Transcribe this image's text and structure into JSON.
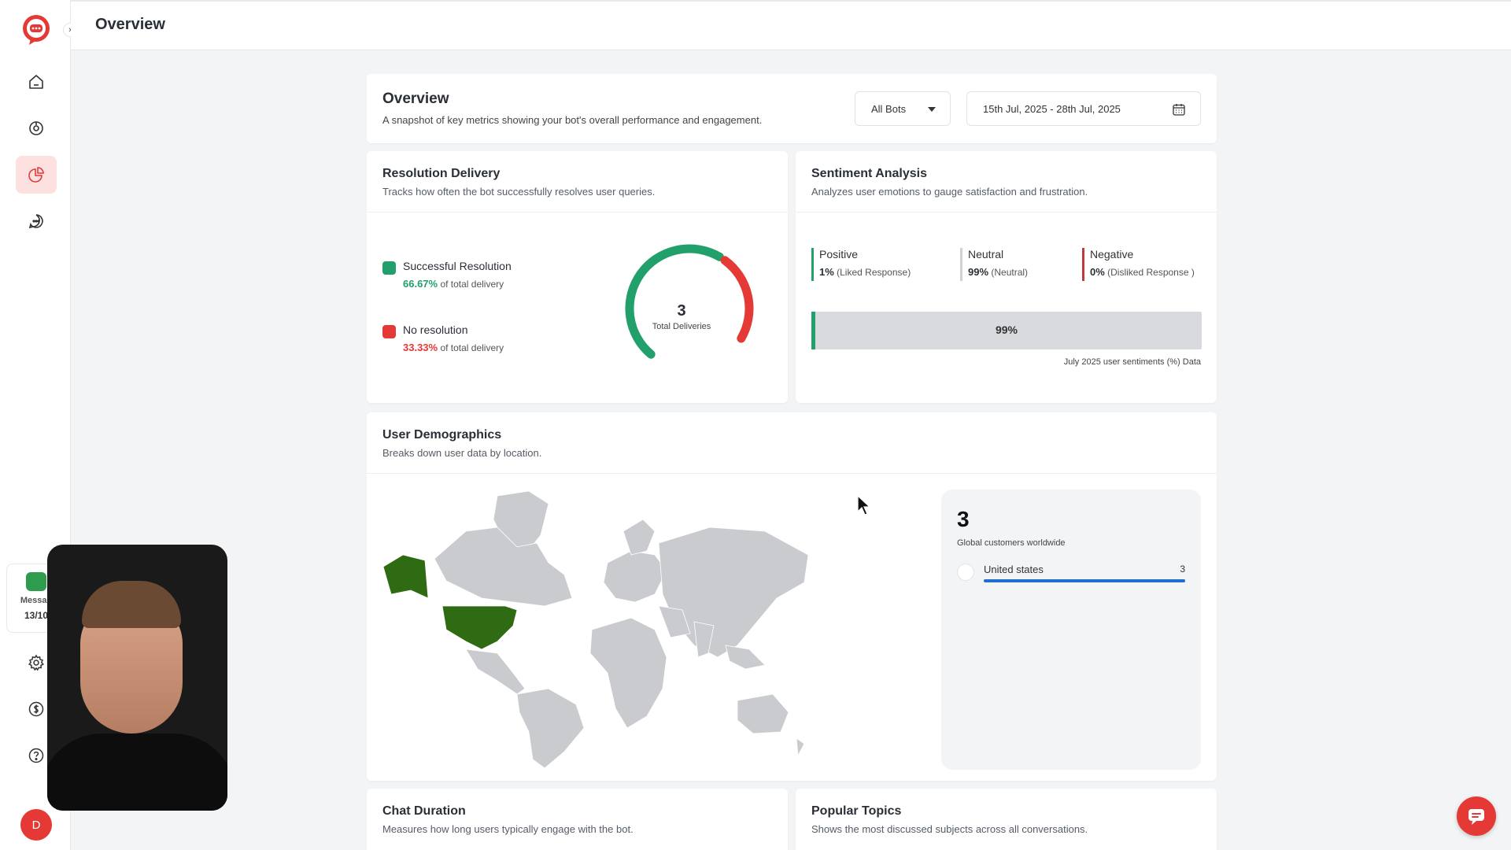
{
  "header": {
    "title": "Overview"
  },
  "sidebar": {
    "nav": [
      {
        "icon": "home-icon"
      },
      {
        "icon": "bot-icon"
      },
      {
        "icon": "analytics-icon",
        "active": true
      },
      {
        "icon": "chat-icon"
      }
    ],
    "message_card": {
      "label": "Messag",
      "count": "13/10"
    },
    "bottom": [
      {
        "icon": "settings-icon"
      },
      {
        "icon": "billing-icon"
      },
      {
        "icon": "help-icon"
      }
    ],
    "user_initial": "D",
    "accent": "#e53935"
  },
  "overview": {
    "title": "Overview",
    "subtitle": "A snapshot of key metrics showing your bot's overall performance and engagement.",
    "bot_select": "All Bots",
    "date_range": "15th Jul, 2025 - 28th Jul, 2025"
  },
  "resolution": {
    "title": "Resolution Delivery",
    "subtitle": "Tracks how often the bot successfully resolves user queries.",
    "items": [
      {
        "label": "Successful Resolution",
        "pct": "66.67%",
        "suffix": "of total delivery",
        "color": "#22a06b",
        "fraction": 0.6667
      },
      {
        "label": "No resolution",
        "pct": "33.33%",
        "suffix": "of total delivery",
        "color": "#e53935",
        "fraction": 0.3333
      }
    ],
    "total": "3",
    "total_label": "Total Deliveries"
  },
  "sentiment": {
    "title": "Sentiment Analysis",
    "subtitle": "Analyzes user emotions to gauge satisfaction and frustration.",
    "items": [
      {
        "name": "Positive",
        "value": "1%",
        "note": "(Liked Response)",
        "color": "#22a06b"
      },
      {
        "name": "Neutral",
        "value": "99%",
        "note": "(Neutral)",
        "color": "#cfd1d5"
      },
      {
        "name": "Negative",
        "value": "0%",
        "note": "(Disliked Response )",
        "color": "#c0393b"
      }
    ],
    "bar_label": "99%",
    "positive_fraction": 0.01,
    "note": "July 2025 user sentiments (%) Data"
  },
  "demographics": {
    "title": "User Demographics",
    "subtitle": "Breaks down user data by location.",
    "total": "3",
    "total_label": "Global customers worldwide",
    "countries": [
      {
        "name": "United states",
        "count": "3",
        "fraction": 1.0
      }
    ],
    "highlight_color": "#2e6b12"
  },
  "chat_duration": {
    "title": "Chat Duration",
    "subtitle": "Measures how long users typically engage with the bot."
  },
  "popular_topics": {
    "title": "Popular Topics",
    "subtitle": "Shows the most discussed subjects across all conversations."
  }
}
